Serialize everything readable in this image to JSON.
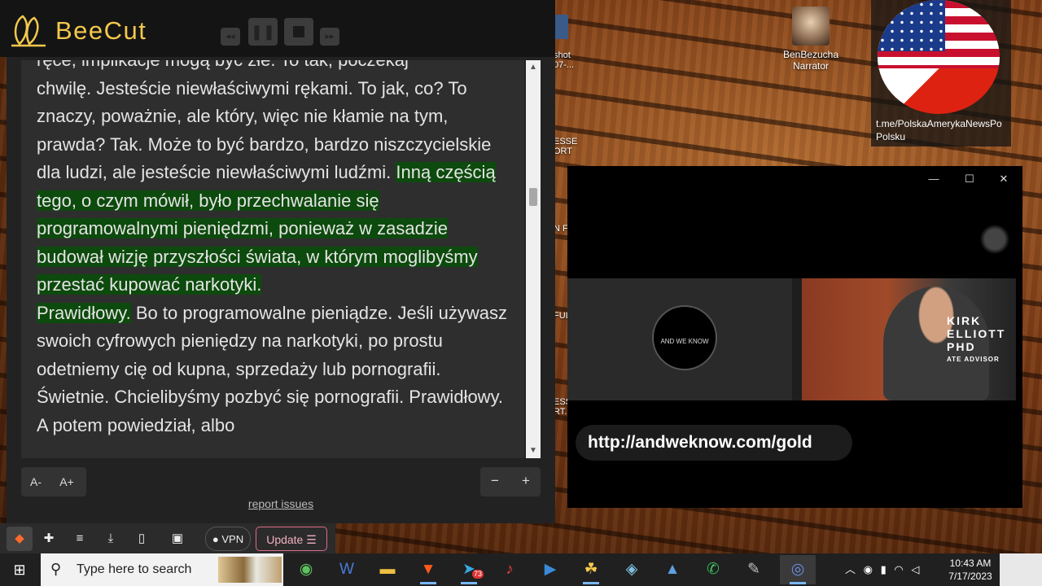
{
  "beecut": {
    "app_name": "BeeCut",
    "prev_label": "◂◂",
    "pause_label": "❚❚",
    "next_label": "▸▸"
  },
  "transcript": {
    "line0": "ręce, implikacje mogą być złe. To tak, poczekaj",
    "seg1": "chwilę. Jesteście niewłaściwymi rękami. To jak, co? To znaczy, poważnie, ale który, więc nie kłamie na tym, prawda? Tak. Może to być bardzo, bardzo niszczycielskie dla ludzi, ale jesteście niewłaściwymi ludźmi. ",
    "highlight": "Inną częścią tego, o czym mówił, było przechwalanie się programowalnymi pieniędzmi, ponieważ w zasadzie budował wizję przyszłości świata, w którym moglibyśmy przestać kupować narkotyki.",
    "highlight2": "Prawidłowy.",
    "seg2": " Bo to programowalne pieniądze. Jeśli używasz swoich cyfrowych pieniędzy na narkotyki, po prostu odetniemy cię od kupna, sprzedaży lub pornografii. Świetnie. Chcielibyśmy pozbyć się pornografii. Prawidłowy. A potem powiedział, albo"
  },
  "controls": {
    "font_decrease": "A-",
    "font_increase": "A+",
    "zoom_out": "−",
    "zoom_in": "+",
    "report_issues": "report issues"
  },
  "browser_toolbar": {
    "vpn": "● VPN",
    "update": "Update ☰"
  },
  "desktop": {
    "ben_icon_label": "BenBezucha Narrator",
    "telegram_label": "t.me/PolskaAmerykaNewsPo Polsku",
    "partial1": "shot 07-...",
    "partial2": "ESSE ORT",
    "partial3": "N F",
    "partial4": "FUL",
    "partial5": "ESS RT."
  },
  "video": {
    "url_overlay": "http://andweknow.com/gold",
    "logo_text": "AND WE KNOW",
    "lower_third_name": "KIRK ELLIOTT PHD",
    "lower_third_sub": "ATE ADVISOR"
  },
  "taskbar": {
    "search_placeholder": "Type here to search",
    "time": "10:43 AM",
    "date": "7/17/2023",
    "telegram_badge": "73"
  }
}
